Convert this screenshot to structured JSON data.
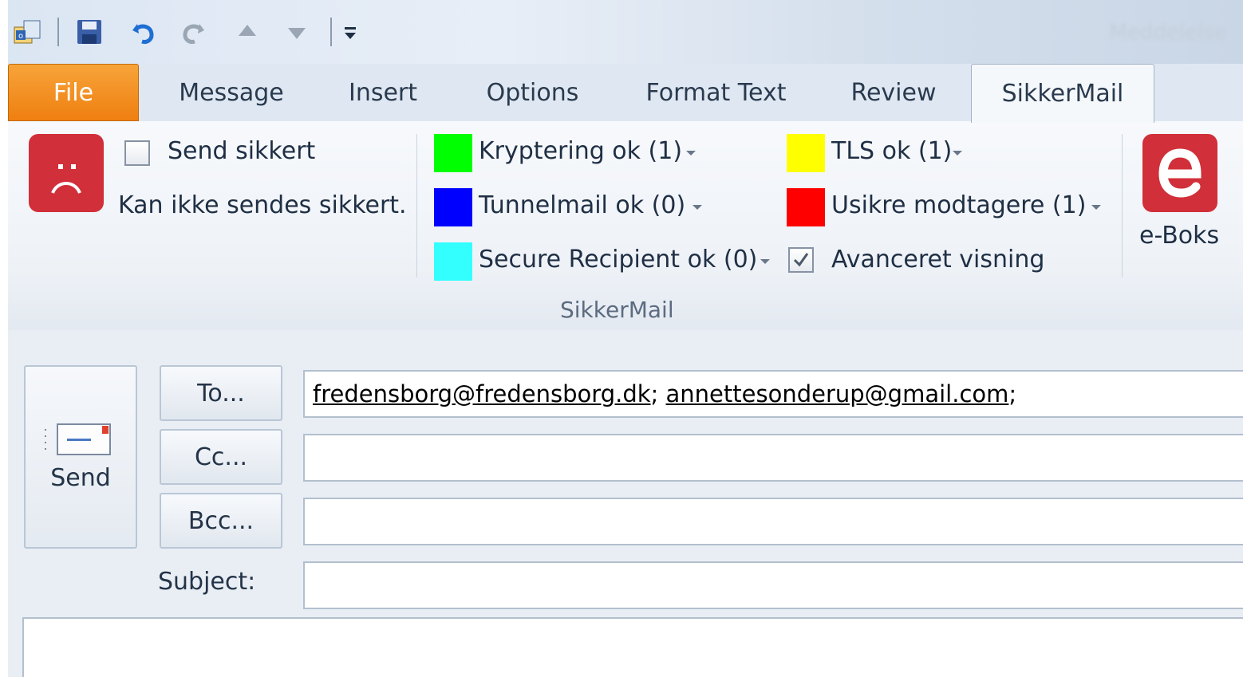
{
  "window": {
    "title": "Meddelelse"
  },
  "quick_access": {
    "icons": [
      "outlook-icon",
      "save-icon",
      "undo-icon",
      "redo-icon",
      "previous-item-icon",
      "next-item-icon",
      "customize-toolbar-icon"
    ]
  },
  "tabs": [
    {
      "label": "File",
      "active": false
    },
    {
      "label": "Message",
      "active": false
    },
    {
      "label": "Insert",
      "active": false
    },
    {
      "label": "Options",
      "active": false
    },
    {
      "label": "Format Text",
      "active": false
    },
    {
      "label": "Review",
      "active": false
    },
    {
      "label": "SikkerMail",
      "active": true
    }
  ],
  "ribbon": {
    "send_secure": {
      "label": "Send sikkert",
      "checked": false
    },
    "status_text": "Kan ikke sendes sikkert.",
    "indicators": {
      "encryption": {
        "label": "Kryptering ok (1)",
        "color": "#00ff00"
      },
      "tunnelmail": {
        "label": "Tunnelmail ok (0)",
        "color": "#0000ff"
      },
      "secure_recipient": {
        "label": "Secure Recipient ok (0)",
        "color": "#33ffff"
      },
      "tls": {
        "label": "TLS ok (1)",
        "color": "#ffff00"
      },
      "unsafe": {
        "label": "Usikre modtagere (1)",
        "color": "#ff0000"
      }
    },
    "advanced_view": {
      "label": "Avanceret visning",
      "checked": true
    },
    "group_label": "SikkerMail",
    "eboks": {
      "label": "e-Boks"
    }
  },
  "compose": {
    "send_label": "Send",
    "to_label": "To...",
    "cc_label": "Cc...",
    "bcc_label": "Bcc...",
    "subject_label": "Subject:",
    "to_recipients": [
      "fredensborg@fredensborg.dk",
      "annettesonderup@gmail.com"
    ],
    "cc_value": "",
    "bcc_value": "",
    "subject_value": ""
  }
}
